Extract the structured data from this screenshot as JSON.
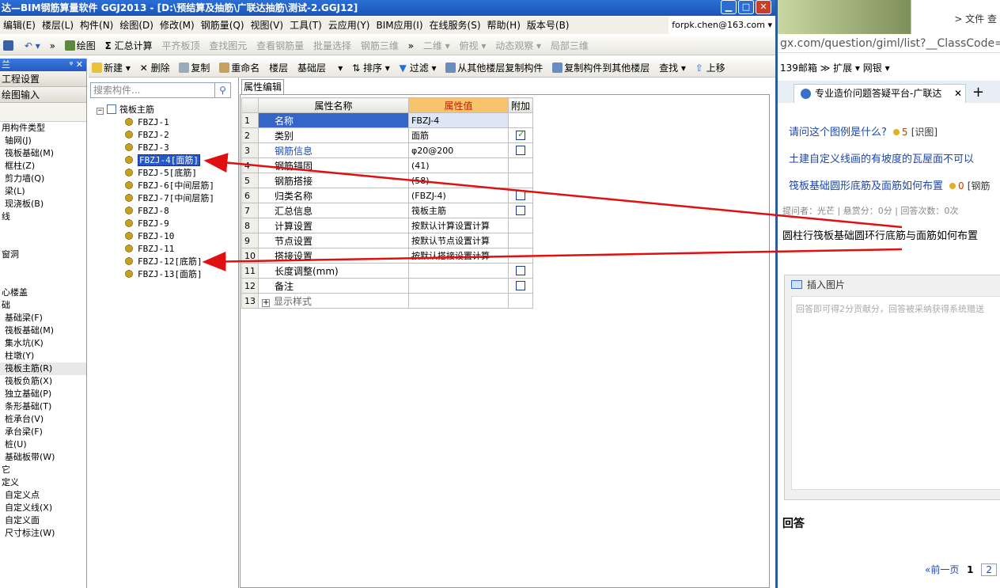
{
  "app": {
    "title": "达—BIM钢筋算量软件 GGJ2013 - [D:\\预结算及抽筋\\广联达抽筋\\测试-2.GGJ12]",
    "user": "forpk.chen@163.com ▾"
  },
  "menu": [
    "编辑(E)",
    "楼层(L)",
    "构件(N)",
    "绘图(D)",
    "修改(M)",
    "钢筋量(Q)",
    "视图(V)",
    "工具(T)",
    "云应用(Y)",
    "BIM应用(I)",
    "在线服务(S)",
    "帮助(H)",
    "版本号(B)"
  ],
  "toolbar1": {
    "draw": "绘图",
    "sum": "汇总计算",
    "flat": "平齐板顶",
    "find": "查找图元",
    "view_rebar": "查看钢筋量",
    "batch": "批量选择",
    "rebar3d": "钢筋三维",
    "view2d": "二维",
    "top": "俯视",
    "dynamic": "动态观察",
    "local3d": "局部三维"
  },
  "toolbar2": {
    "new": "新建",
    "delete": "删除",
    "copy": "复制",
    "rename": "重命名",
    "floor_label": "楼层",
    "floor_value": "基础层",
    "sort": "排序",
    "filter": "过滤",
    "copy_from": "从其他楼层复制构件",
    "copy_to": "复制构件到其他楼层",
    "find": "查找",
    "up": "上移"
  },
  "left": {
    "header": "兰",
    "sections": [
      "工程设置",
      "绘图输入"
    ],
    "items": [
      {
        "label": "用构件类型",
        "indent": false
      },
      {
        "label": "轴网(J)",
        "indent": true
      },
      {
        "label": "筏板基础(M)",
        "indent": true
      },
      {
        "label": "框柱(Z)",
        "indent": true
      },
      {
        "label": "剪力墙(Q)",
        "indent": true
      },
      {
        "label": "梁(L)",
        "indent": true
      },
      {
        "label": "现浇板(B)",
        "indent": true
      },
      {
        "label": "线",
        "indent": false
      },
      {
        "label": "",
        "indent": false
      },
      {
        "label": "",
        "indent": false
      },
      {
        "label": "窗洞",
        "indent": false
      },
      {
        "label": "",
        "indent": false
      },
      {
        "label": "",
        "indent": false
      },
      {
        "label": "心楼盖",
        "indent": false
      },
      {
        "label": "础",
        "indent": false
      },
      {
        "label": "基础梁(F)",
        "indent": true
      },
      {
        "label": "筏板基础(M)",
        "indent": true
      },
      {
        "label": "集水坑(K)",
        "indent": true
      },
      {
        "label": "柱墩(Y)",
        "indent": true
      },
      {
        "label": "筏板主筋(R)",
        "indent": true,
        "selected": true
      },
      {
        "label": "筏板负筋(X)",
        "indent": true
      },
      {
        "label": "独立基础(P)",
        "indent": true
      },
      {
        "label": "条形基础(T)",
        "indent": true
      },
      {
        "label": "桩承台(V)",
        "indent": true
      },
      {
        "label": "承台梁(F)",
        "indent": true
      },
      {
        "label": "桩(U)",
        "indent": true
      },
      {
        "label": "基础板带(W)",
        "indent": true
      },
      {
        "label": "它",
        "indent": false
      },
      {
        "label": "定义",
        "indent": false
      },
      {
        "label": "自定义点",
        "indent": true
      },
      {
        "label": "自定义线(X)",
        "indent": true
      },
      {
        "label": "自定义面",
        "indent": true
      },
      {
        "label": "尺寸标注(W)",
        "indent": true
      }
    ]
  },
  "tree": {
    "search_placeholder": "搜索构件...",
    "root": "筏板主筋",
    "items": [
      "FBZJ-1",
      "FBZJ-2",
      "FBZJ-3",
      "FBZJ-4[面筋]",
      "FBZJ-5[底筋]",
      "FBZJ-6[中间层筋]",
      "FBZJ-7[中间层筋]",
      "FBZJ-8",
      "FBZJ-9",
      "FBZJ-10",
      "FBZJ-11",
      "FBZJ-12[底筋]",
      "FBZJ-13[面筋]"
    ],
    "selected_index": 3
  },
  "props": {
    "tab": "属性编辑",
    "headers": {
      "name": "属性名称",
      "value": "属性值",
      "extra": "附加"
    },
    "rows": [
      {
        "n": "1",
        "name": "名称",
        "value": "FBZJ-4",
        "check": null,
        "blue": false
      },
      {
        "n": "2",
        "name": "类别",
        "value": "面筋",
        "check": true,
        "blue": false
      },
      {
        "n": "3",
        "name": "钢筋信息",
        "value": "φ20@200",
        "check": false,
        "blue": true
      },
      {
        "n": "4",
        "name": "钢筋锚固",
        "value": "(41)",
        "check": null,
        "blue": false
      },
      {
        "n": "5",
        "name": "钢筋搭接",
        "value": "(58)",
        "check": null,
        "blue": false
      },
      {
        "n": "6",
        "name": "归类名称",
        "value": "(FBZJ-4)",
        "check": false,
        "blue": false
      },
      {
        "n": "7",
        "name": "汇总信息",
        "value": "筏板主筋",
        "check": false,
        "blue": false
      },
      {
        "n": "8",
        "name": "计算设置",
        "value": "按默认计算设置计算",
        "check": null,
        "blue": false
      },
      {
        "n": "9",
        "name": "节点设置",
        "value": "按默认节点设置计算",
        "check": null,
        "blue": false
      },
      {
        "n": "10",
        "name": "搭接设置",
        "value": "按默认搭接设置计算",
        "check": null,
        "blue": false
      },
      {
        "n": "11",
        "name": "长度调整(mm)",
        "value": "",
        "check": false,
        "blue": false
      },
      {
        "n": "12",
        "name": "备注",
        "value": "",
        "check": false,
        "blue": false
      },
      {
        "n": "13",
        "name": "显示样式",
        "value": "",
        "check": null,
        "blue": false,
        "expand": true
      }
    ]
  },
  "browser": {
    "menu": "> 文件  查",
    "url": "gx.com/question/giml/list?__ClassCode=-18",
    "bookmarks": "139邮箱  ≫   扩展 ▾   网银 ▾",
    "tab_title": "专业造价问题答疑平台-广联达",
    "links": [
      {
        "text": "请问这个图例是什么?",
        "count": "5",
        "tag": "[识图]"
      },
      {
        "text": "土建自定义线画的有坡度的瓦屋面不可以",
        "count": "",
        "tag": ""
      },
      {
        "text": "筏板基础圆形底筋及面筋如何布置",
        "count": "0",
        "tag": "[钢筋"
      }
    ],
    "meta": "提问者：光芒  |  悬赏分：0分  |  回答次数：0次",
    "question": "圆柱行筏板基础圆环行底筋与面筋如何布置",
    "insert_image": "插入图片",
    "answer_placeholder": "回答即可得2分贡献分，回答被采纳获得系统赠送",
    "answer_label": "回答",
    "pager": {
      "prev": "«前一页",
      "current": "1",
      "next": "2"
    }
  },
  "colors": {
    "title_blue": "#1c54b8",
    "arrow_red": "#e01010",
    "selected_blue": "#2458c8",
    "value_header": "#f7c36d"
  }
}
